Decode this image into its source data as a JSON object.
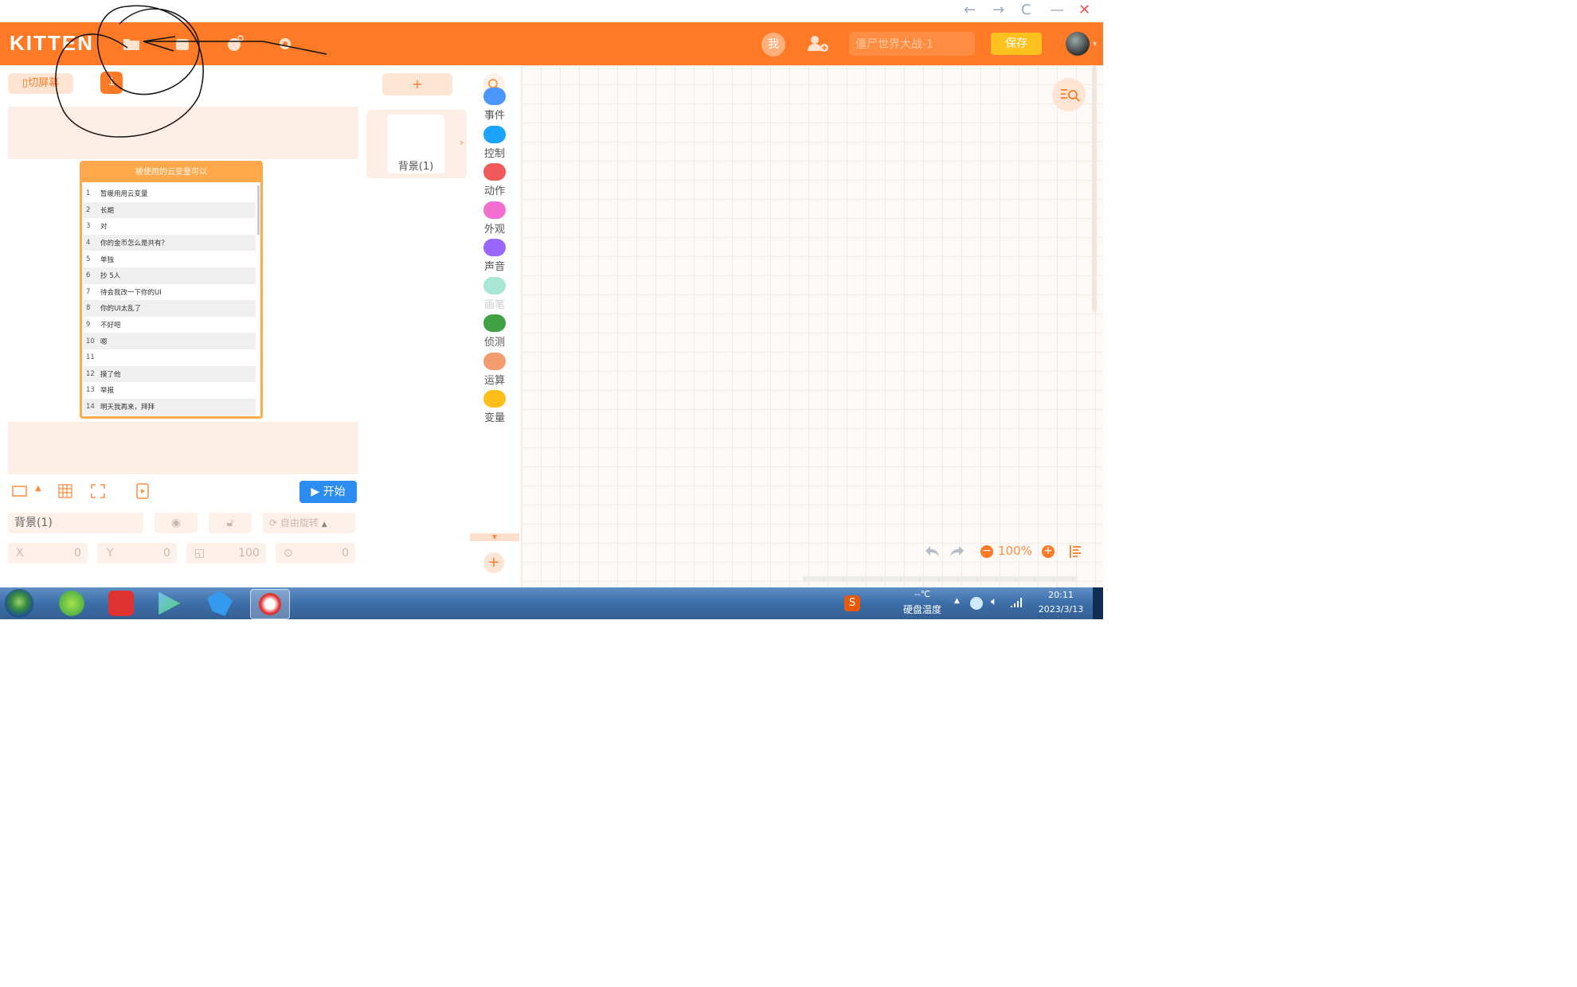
{
  "window": {
    "back": "←",
    "forward": "→",
    "refresh": "C",
    "minimize": "—",
    "close": "✕"
  },
  "header": {
    "logo": "KITTEN",
    "me_label": "我",
    "project_name": "僵尸世界大战-1",
    "save_label": "保存"
  },
  "stage": {
    "mode_label": "切屏幕",
    "scene_number": "1",
    "start_label": "开始",
    "list": {
      "title": "被使用的云变量可以",
      "rows": [
        {
          "n": "1",
          "t": "暂暖用用云变量"
        },
        {
          "n": "2",
          "t": "长期"
        },
        {
          "n": "3",
          "t": "对"
        },
        {
          "n": "4",
          "t": "你的金币怎么是共有？"
        },
        {
          "n": "5",
          "t": "单独"
        },
        {
          "n": "6",
          "t": "抄 5人"
        },
        {
          "n": "7",
          "t": "待会我改一下你的UI"
        },
        {
          "n": "8",
          "t": "你的UI太乱了"
        },
        {
          "n": "9",
          "t": "不好吧"
        },
        {
          "n": "10",
          "t": "嗯"
        },
        {
          "n": "11",
          "t": ""
        },
        {
          "n": "12",
          "t": "摸了他"
        },
        {
          "n": "13",
          "t": "举报"
        },
        {
          "n": "14",
          "t": "明天我再来，拜拜"
        }
      ]
    }
  },
  "properties": {
    "name": "背景(1)",
    "rotation_label": "自由旋转",
    "x_label": "X",
    "x_value": "0",
    "y_label": "Y",
    "y_value": "0",
    "size_value": "100",
    "direction_value": "0"
  },
  "backgrounds": {
    "add_label": "+",
    "items": [
      {
        "label": "背景(1)"
      }
    ]
  },
  "categories": [
    {
      "label": "事件",
      "color": "#4c97ff"
    },
    {
      "label": "控制",
      "color": "#1aa3ff"
    },
    {
      "label": "动作",
      "color": "#f05a5a"
    },
    {
      "label": "外观",
      "color": "#f26fd0"
    },
    {
      "label": "声音",
      "color": "#9966ff"
    },
    {
      "label": "画笔",
      "color": "#a9e6d3"
    },
    {
      "label": "侦测",
      "color": "#3fa142"
    },
    {
      "label": "运算",
      "color": "#f29c70"
    },
    {
      "label": "变量",
      "color": "#ffbf1a"
    }
  ],
  "workspace": {
    "zoom": "100%"
  },
  "taskbar": {
    "temp": "--℃",
    "temp_label": "硬盘温度",
    "time": "20:11",
    "date": "2023/3/13"
  }
}
